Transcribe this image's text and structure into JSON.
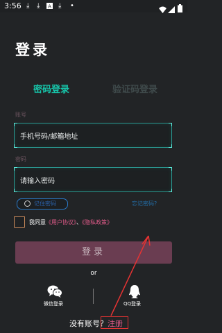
{
  "status_bar": {
    "time": "3:56",
    "icons": [
      "download-icon",
      "download-icon",
      "font-a-icon",
      "download-icon",
      "dot-icon"
    ],
    "right_icons": [
      "wifi-icon",
      "cellular-icon",
      "battery-icon"
    ]
  },
  "page_title": "登录",
  "tabs": [
    {
      "label": "密码登录",
      "active": true
    },
    {
      "label": "验证码登录",
      "active": false
    }
  ],
  "account": {
    "label": "账号",
    "placeholder": "手机号码/邮箱地址"
  },
  "password": {
    "label": "密码",
    "placeholder": "请输入密码"
  },
  "remember_label": "记住密码",
  "forgot_label": "忘记密码?",
  "agreement": {
    "prefix": "我同意",
    "user_agreement": "《用户协议》",
    "separator": "、",
    "privacy_policy": "《隐私政策》"
  },
  "login_button": "登录",
  "or_text": "or",
  "social": {
    "wechat_label": "微信登录",
    "qq_label": "QQ登录"
  },
  "register": {
    "prompt": "没有账号？",
    "link": "注册"
  },
  "colors": {
    "background": "#222426",
    "accent_teal": "#17c4a9",
    "accent_pink": "#e25b8a",
    "button_bg": "#6a3d51",
    "annotation_red": "#e53333"
  }
}
